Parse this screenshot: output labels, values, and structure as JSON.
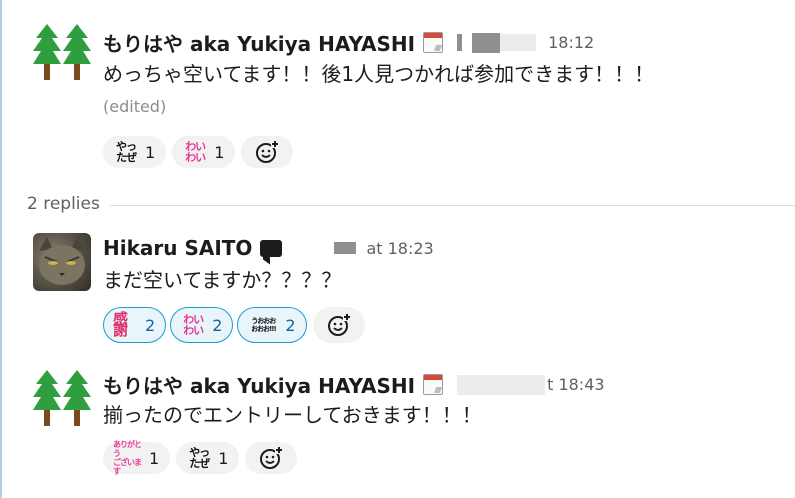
{
  "messages": [
    {
      "author": "もりはや aka Yukiya HAYASHI",
      "time": "18:12",
      "text": "めっちゃ空いてます！！後1人見つかれば参加できます！！！",
      "edited": "(edited)",
      "reactions": [
        {
          "emoji": "yattase",
          "glyph_top": "やっ",
          "glyph_bottom": "たぜ",
          "count": "1"
        },
        {
          "emoji": "waiwai",
          "glyph_top": "わい",
          "glyph_bottom": "わい",
          "count": "1"
        }
      ]
    },
    {
      "author": "Hikaru SAITO",
      "time": "at 18:23",
      "text": "まだ空いてますか？？？？",
      "reactions": [
        {
          "emoji": "kansha",
          "glyph_top": "感謝",
          "glyph_bottom": "",
          "count": "2"
        },
        {
          "emoji": "waiwai",
          "glyph_top": "わい",
          "glyph_bottom": "わい",
          "count": "2"
        },
        {
          "emoji": "uoooo",
          "glyph_top": "うおおお",
          "glyph_bottom": "おおお!!!",
          "count": "2"
        }
      ]
    },
    {
      "author": "もりはや aka Yukiya HAYASHI",
      "time": "t 18:43",
      "text": "揃ったのでエントリーしておきます！！！",
      "reactions": [
        {
          "emoji": "arigatou",
          "glyph_top": "ありがとう",
          "glyph_bottom": "ございます",
          "count": "1"
        },
        {
          "emoji": "yattase",
          "glyph_top": "やっ",
          "glyph_bottom": "たぜ",
          "count": "1"
        }
      ]
    }
  ],
  "thread": {
    "replies_label": "2 replies"
  },
  "icons": {
    "avatar_trees": "tree-avatar",
    "avatar_cat": "cat-avatar",
    "status_calendar": "calendar-icon",
    "status_speech": "speech-bubble-icon",
    "add_reaction": "add-reaction-icon"
  },
  "colors": {
    "tree_green": "#2e9e3e",
    "trunk_brown": "#7a4a1f",
    "selected_reaction_border": "#1d9bd1",
    "selected_reaction_bg": "#e8f5fa",
    "selected_reaction_count": "#1264a3",
    "emoji_pink": "#e8389a"
  }
}
